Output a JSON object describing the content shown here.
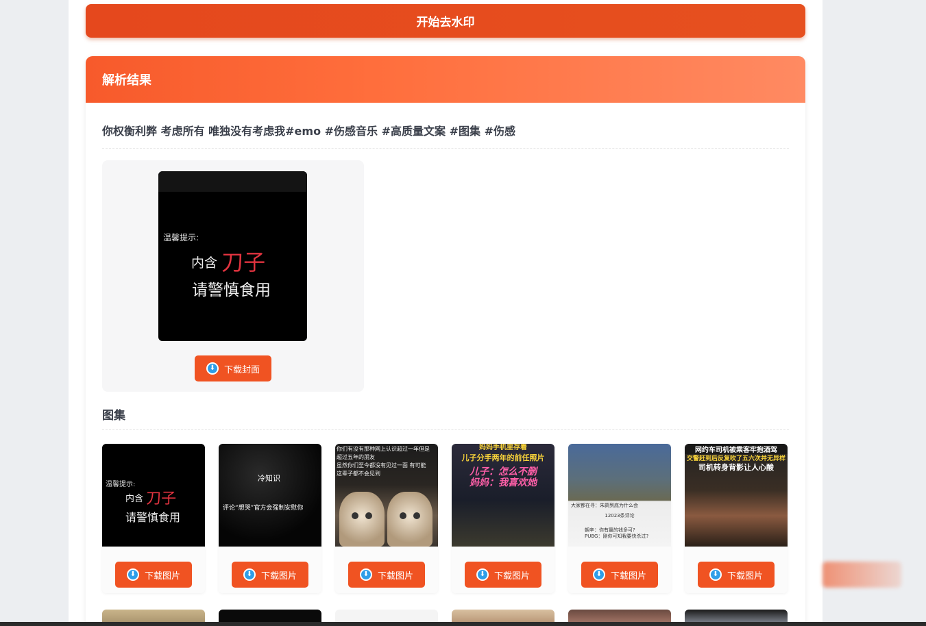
{
  "actions": {
    "start_label": "开始去水印"
  },
  "result": {
    "header": "解析结果",
    "post_title": "你权衡利弊 考虑所有 唯独没有考虑我#emo #伤感音乐 #高质量文案 #图集 #伤感",
    "cover": {
      "warn_small": "温馨提示:",
      "warn_prefix": "内含",
      "warn_highlight": "刀子",
      "warn_line2": "请警慎食用",
      "download_label": "下载封面"
    },
    "gallery": {
      "title": "图集",
      "download_label": "下载图片",
      "items": [
        {
          "small": "温馨提示:",
          "prefix": "内含",
          "highlight": "刀子",
          "line2": "请警慎食用"
        },
        {
          "t1": "冷知识",
          "t2": "评论“想哭”官方会强制安慰你"
        },
        {
          "text1": "你们有没有那种网上认识超过一年但是",
          "text2": "超过五年的朋友",
          "text3": "虽然你们至今都没有见过一面 有可能",
          "text4": "这辈子都不会见到"
        },
        {
          "y1": "妈妈手机里存着",
          "y2": "儿子分手两年的前任照片",
          "p1": "儿子：怎么不删",
          "p2": "妈妈：我喜欢她"
        },
        {
          "bar": "大家都在寻：朱鹮到底为什么会",
          "count": "12023条评论",
          "comment1": "朝辛：你有赢的钱多可?",
          "comment2": "PUBG：刚你可知我要快杀过?"
        },
        {
          "h1": "网约车司机被乘客牢抱酒驾",
          "h2": "交警赶到后反复吹了五六次并无异样",
          "h3": "司机转身背影让人心酸"
        }
      ]
    }
  },
  "colors": {
    "accent": "#f05322",
    "header_from": "#f75a2b",
    "header_to": "#ff8a62",
    "icon_blue": "#2f9ee8"
  }
}
